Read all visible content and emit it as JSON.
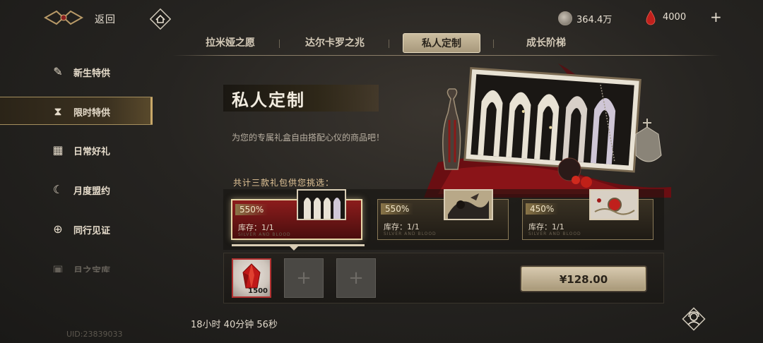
{
  "topbar": {
    "back_label": "返回",
    "currency_coin": "364.4万",
    "currency_gem": "4000",
    "plus": "+"
  },
  "tabs": [
    {
      "label": "拉米娅之愿",
      "active": false
    },
    {
      "label": "达尔卡罗之兆",
      "active": false
    },
    {
      "label": "私人定制",
      "active": true
    },
    {
      "label": "成长阶梯",
      "active": false
    }
  ],
  "sidebar": {
    "items": [
      {
        "label": "新生特供",
        "icon": "horn-icon"
      },
      {
        "label": "限时特供",
        "icon": "hourglass-icon",
        "active": true
      },
      {
        "label": "日常好礼",
        "icon": "gift-icon"
      },
      {
        "label": "月度盟约",
        "icon": "moon-icon"
      },
      {
        "label": "同行见证",
        "icon": "compass-icon"
      },
      {
        "label": "月之宝库",
        "icon": "chest-icon"
      }
    ],
    "uid": "UID:23839033"
  },
  "main": {
    "title": "私人定制",
    "subtitle": "为您的专属礼盒自由搭配心仪的商品吧！",
    "pick_label": "共计三款礼包供您挑选："
  },
  "packages": [
    {
      "percent": "550%",
      "stock": "库存：1/1",
      "tiny": "SILVER AND BLOOD",
      "selected": true
    },
    {
      "percent": "550%",
      "stock": "库存：1/1",
      "tiny": "SILVER AND BLOOD",
      "selected": false
    },
    {
      "percent": "450%",
      "stock": "库存：1/1",
      "tiny": "SILVER AND BLOOD",
      "selected": false
    }
  ],
  "slots": [
    {
      "type": "filled",
      "item": "red-crystal",
      "qty": "1500"
    },
    {
      "type": "empty",
      "symbol": "+"
    },
    {
      "type": "empty",
      "symbol": "+"
    }
  ],
  "purchase": {
    "price": "¥128.00"
  },
  "timer": "18小时 40分钟 56秒",
  "colors": {
    "accent_gold": "#c8a868",
    "gem_red": "#c0201c",
    "selected_border": "#e8d7a8"
  }
}
